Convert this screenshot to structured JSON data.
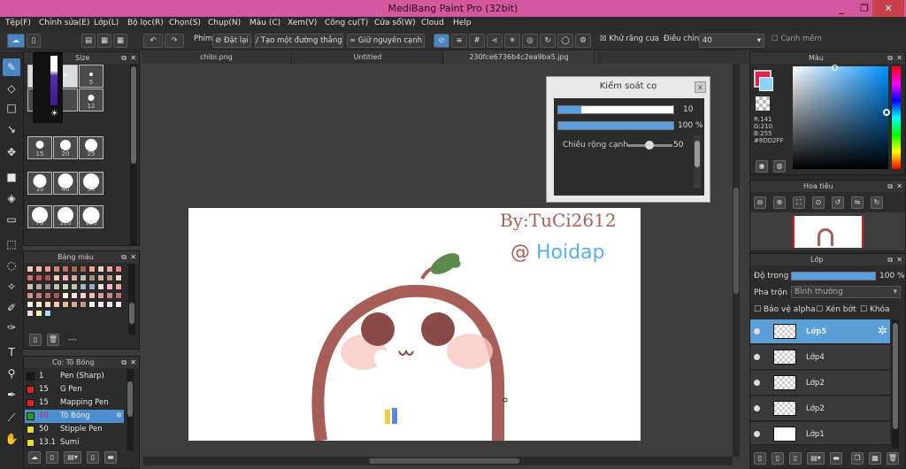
{
  "window": {
    "title": "MediBang Paint Pro (32bit)",
    "minimize": "_",
    "restore": "❐",
    "close": "✕"
  },
  "menu": [
    "Tệp(F)",
    "Chỉnh sửa(E)",
    "Lớp(L)",
    "Bộ lọc(R)",
    "Chọn(S)",
    "Chụp(N)",
    "Màu (C)",
    "Xem(V)",
    "Công cụ(T)",
    "Cửa sổ(W)",
    "Cloud",
    "Help"
  ],
  "toolbar": {
    "phim_label": "Phím",
    "reset_label": "Đặt lại",
    "straight_line_label": "Tạo một đường thẳng",
    "keep_edge_label": "Giữ nguyên cạnh",
    "antialias_label": "Khử răng cưa",
    "correction_label": "Điều chỉnh",
    "correction_value": "40",
    "snap_label": "Cạnh mềm"
  },
  "doc_tabs": [
    "chibi.png",
    "Untitled",
    "230fce6736b4c2ea9ba5.jpg"
  ],
  "brush_size_panel": {
    "title": "Size",
    "sizes": [
      "",
      "",
      "5",
      "",
      "",
      "12",
      "15",
      "20",
      "25",
      "30",
      "40",
      "50",
      "70",
      "100",
      "150"
    ]
  },
  "palette_panel": {
    "title": "Bảng màu",
    "swatches": [
      "#f4c9b8",
      "#f5b8a0",
      "#e89a88",
      "#d48572",
      "#c07060",
      "#b36655",
      "#a95f50",
      "#f0a890",
      "#e8d0c8",
      "#f2a0a0",
      "#e88080",
      "#d86868",
      "#c05858",
      "#b05050",
      "#ecc8b8",
      "#f0b0b0",
      "#e0a8a0",
      "#c8b8b0",
      "#a89080",
      "#d8b0a0",
      "#c89888",
      "#f0d0c0",
      "#d8c0b0",
      "#b8a8a0",
      "#a09088",
      "#c0c0b8",
      "#d0d8c8",
      "#b8c8b0",
      "#a8b8c8",
      "#98a8b8",
      "#f8e0d8",
      "#f0c0b8",
      "#e8a8a0",
      "#d89088",
      "#c87878",
      "#b86868",
      "#a85858",
      "#fff0e8",
      "#ffe0e0",
      "#ffd0c8",
      "#f0b8b0",
      "#e0a098",
      "#d08880",
      "#c07068",
      "#fff8e0",
      "#ffe8d0",
      "#ffd8c0",
      "#f8c8b0",
      "#e8b8a0",
      "#d8a890",
      "#c89880",
      "#ffffff",
      "#f8f0f0",
      "#f0e0e0",
      "#ffe8f0",
      "#ffd8e8",
      "#fff8a0",
      "#a0e0f8"
    ],
    "footer_text": "---"
  },
  "brush_list_panel": {
    "title": "Cọ: Tô Bóng",
    "items": [
      {
        "size": "1",
        "name": "Pen (Sharp)",
        "color": "#1a1a1a"
      },
      {
        "size": "15",
        "name": "G Pen",
        "color": "#e02020"
      },
      {
        "size": "15",
        "name": "Mapping Pen",
        "color": "#e02020"
      },
      {
        "size": "10",
        "name": "Tô Bóng",
        "color": "#20a020"
      },
      {
        "size": "50",
        "name": "Stipple Pen",
        "color": "#e8e020"
      },
      {
        "size": "13.1",
        "name": "Sumi",
        "color": "#e8e020"
      }
    ]
  },
  "brush_control": {
    "title": "Kiểm soát cọ",
    "close": "x",
    "size_value": "10",
    "size_fill": 0.2,
    "opacity_value": "100 %",
    "opacity_fill": 1.0,
    "edge_label": "Chiều rộng cạnh",
    "edge_value": "50",
    "edge_fill": 0.5
  },
  "color_panel": {
    "title": "Màu",
    "r": "R:141",
    "g": "G:210",
    "b": "B:255",
    "hex": "#8DD2FF"
  },
  "navigator_panel": {
    "title": "Hoa tiêu"
  },
  "layer_panel": {
    "title": "Lớp",
    "opacity_label": "Độ trong",
    "opacity_value": "100 %",
    "opacity_fill": 1.0,
    "blend_label": "Pha trộn",
    "blend_value": "Bình thường",
    "protect_alpha_label": "Bảo vệ alpha",
    "clipping_label": "Xén bớt",
    "lock_label": "Khóa",
    "layers": [
      {
        "name": "Lớp5",
        "selected": true
      },
      {
        "name": "Lớp4",
        "selected": false
      },
      {
        "name": "Lớp2",
        "selected": false
      },
      {
        "name": "Lớp2",
        "selected": false
      },
      {
        "name": "Lớp1",
        "selected": false
      }
    ]
  },
  "canvas_art": {
    "line1": "By:TuCi2612",
    "line2_prefix": "@",
    "line2_word": "Hoidap"
  }
}
